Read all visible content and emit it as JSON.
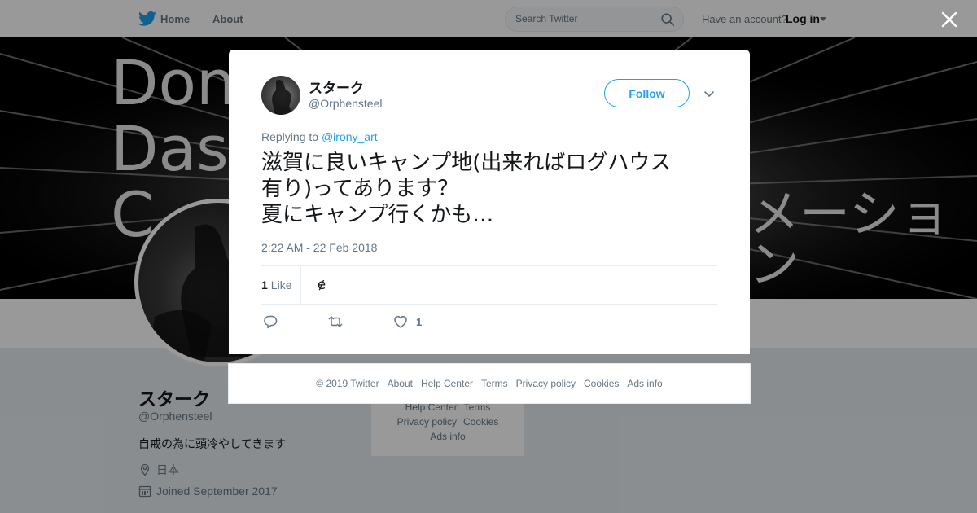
{
  "topbar": {
    "home_label": "Home",
    "about_label": "About",
    "search_placeholder": "Search Twitter",
    "account_text": "Have an account?",
    "login_label": "Log in"
  },
  "banner": {
    "lines": [
      "Don",
      "Dasa",
      "C"
    ],
    "right_text": "メーション"
  },
  "profile": {
    "name": "スターク",
    "handle": "@Orphensteel",
    "bio": "自戒の為に頭冷やしてきます",
    "location": "日本",
    "joined": "Joined September 2017"
  },
  "side_footer": {
    "row1": [
      "Help Center",
      "Terms"
    ],
    "row2": [
      "Privacy policy",
      "Cookies"
    ],
    "row3": [
      "Ads info"
    ]
  },
  "tweet": {
    "name": "スターク",
    "handle": "@Orphensteel",
    "follow_label": "Follow",
    "replying_prefix": "Replying to",
    "replying_to": "@irony_art",
    "text": "滋賀に良いキャンプ地(出来ればログハウス\n有り)ってあります？\n夏にキャンプ行くかも…",
    "timestamp": "2:22 AM - 22 Feb 2018",
    "like_count": "1",
    "like_label": "Like",
    "liker_glyph": "ɇ",
    "action_like_count": "1"
  },
  "footer": {
    "links": [
      "© 2019 Twitter",
      "About",
      "Help Center",
      "Terms",
      "Privacy policy",
      "Cookies",
      "Ads info"
    ]
  },
  "colors": {
    "accent": "#1da1f2",
    "muted": "#657786",
    "text": "#14171a",
    "overlay": "rgba(0,0,0,0.4)"
  }
}
